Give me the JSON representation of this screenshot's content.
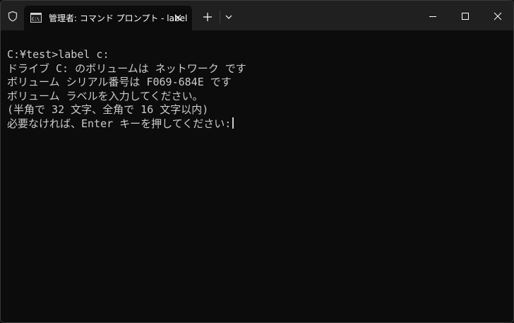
{
  "window": {
    "tab_title": "管理者: コマンド プロンプト - label",
    "shield_icon": "shield-icon",
    "tab_icon": "cmd-icon",
    "close_tab_icon": "close-icon",
    "new_tab_icon": "plus-icon",
    "dropdown_icon": "chevron-down-icon",
    "minimize_icon": "minimize-icon",
    "maximize_icon": "maximize-icon",
    "close_window_icon": "close-icon"
  },
  "terminal": {
    "lines": [
      "C:¥test>label c:",
      "ドライブ C: のボリュームは ネットワーク です",
      "ボリューム シリアル番号は F069-684E です",
      "ボリューム ラベルを入力してください。",
      "(半角で 32 文字、全角で 16 文字以内)",
      "必要なければ、Enter キーを押してください:"
    ]
  },
  "colors": {
    "titlebar": "#202020",
    "terminal_bg": "#0c0c0c",
    "terminal_text": "#cccccc"
  }
}
